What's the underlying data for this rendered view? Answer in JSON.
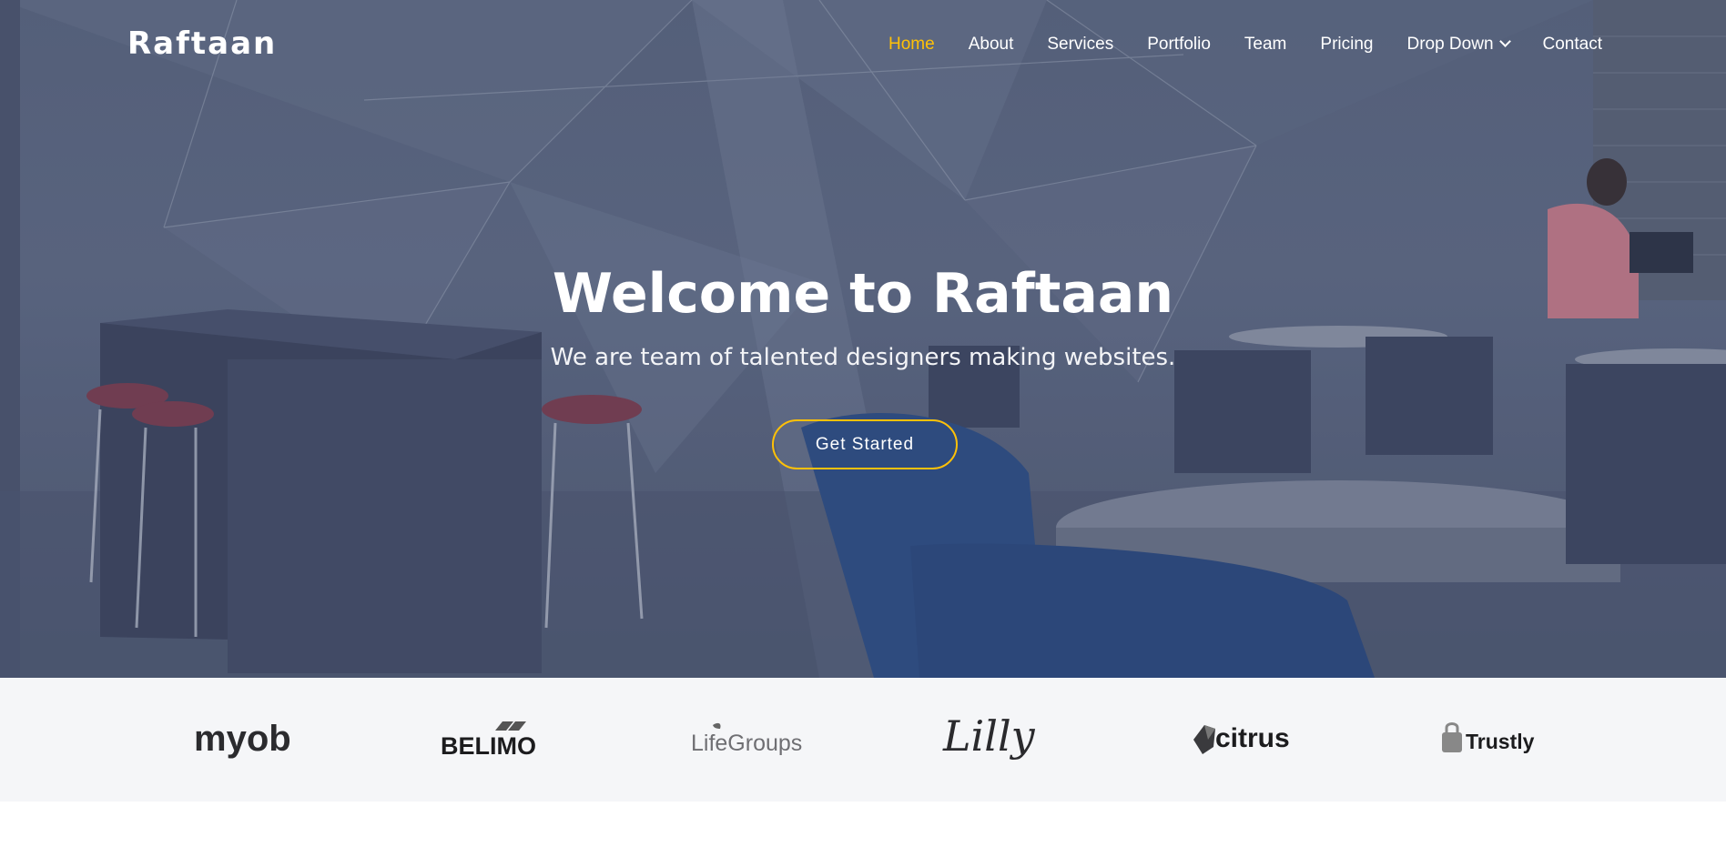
{
  "brand": {
    "name": "Raftaan"
  },
  "nav": {
    "items": [
      {
        "label": "Home",
        "active": true
      },
      {
        "label": "About"
      },
      {
        "label": "Services"
      },
      {
        "label": "Portfolio"
      },
      {
        "label": "Team"
      },
      {
        "label": "Pricing"
      },
      {
        "label": "Drop Down",
        "has_dropdown": true,
        "icon": "chevron-down-icon"
      },
      {
        "label": "Contact"
      }
    ]
  },
  "hero": {
    "title": "Welcome to Raftaan",
    "subtitle": "We are team of talented designers making websites.",
    "cta_label": "Get Started"
  },
  "clients": {
    "logos": [
      "myob",
      "BELIMO",
      "LifeGroups",
      "Lilly",
      "citrus",
      "Trustly"
    ]
  },
  "colors": {
    "accent": "#ffc107",
    "hero_overlay": "#5b6680",
    "clients_bg": "#f5f6f8",
    "text_light": "#ffffff"
  }
}
